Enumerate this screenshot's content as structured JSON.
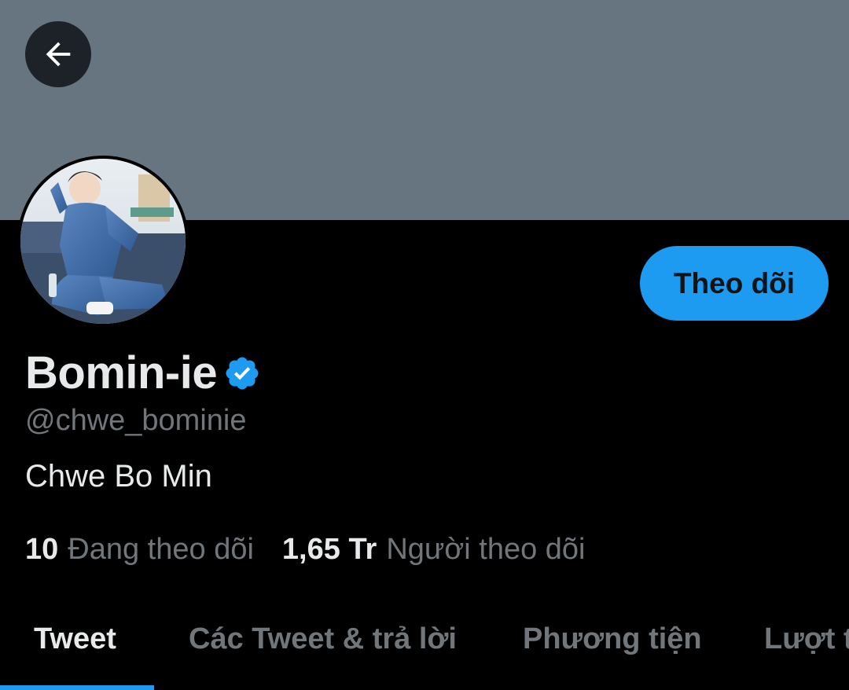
{
  "header": {
    "back_icon": "arrow-left-icon",
    "banner_color": "#66757f"
  },
  "profile": {
    "display_name": "Bomin-ie",
    "verified_icon": "verified-badge-icon",
    "handle": "@chwe_bominie",
    "bio": "Chwe Bo Min",
    "follow_button_label": "Theo dõi",
    "following_count": "10",
    "following_label": "Đang theo dõi",
    "followers_count": "1,65 Tr",
    "followers_label": "Người theo dõi"
  },
  "tabs": [
    {
      "label": "Tweet",
      "active": true
    },
    {
      "label": "Các Tweet & trả lời",
      "active": false
    },
    {
      "label": "Phương tiện",
      "active": false
    },
    {
      "label": "Lượt t",
      "active": false
    }
  ],
  "colors": {
    "accent": "#1d9bf0",
    "background": "#000000",
    "primary_text": "#e7e9ea",
    "secondary_text": "#71767b"
  }
}
